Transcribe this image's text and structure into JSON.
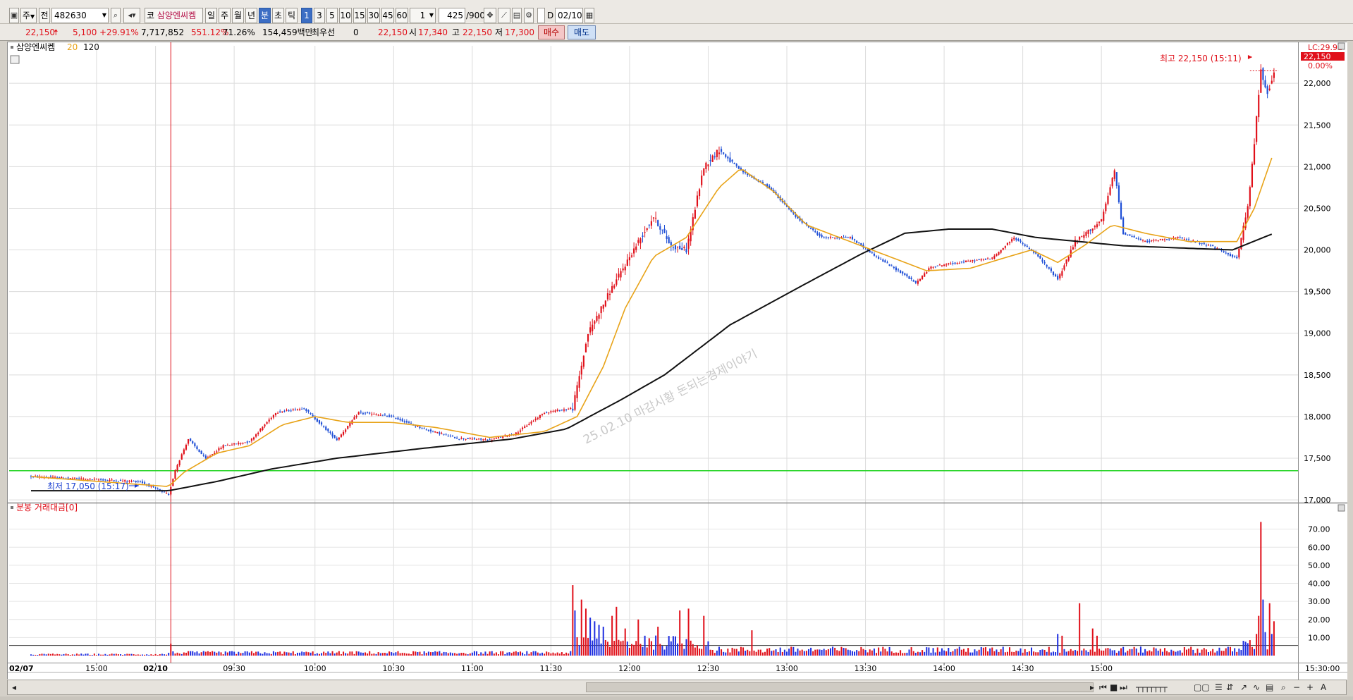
{
  "toolbar": {
    "market_toggle": "주",
    "scope_label": "전",
    "code": "482630",
    "market_prefix": "코",
    "stock_name": "삼양엔씨켐",
    "periods": [
      "일",
      "주",
      "월",
      "년",
      "분",
      "초",
      "틱"
    ],
    "active_period": "분",
    "intervals": [
      "1",
      "3",
      "5",
      "10",
      "15",
      "30",
      "45",
      "60"
    ],
    "active_interval": "1",
    "multiplier": "1",
    "count": "425",
    "count_total": "/900",
    "date_check_label": "D",
    "date": "02/10"
  },
  "quote": {
    "price": "22,150",
    "change": "5,100",
    "change_pct": "+29.91%",
    "volume": "7,717,852",
    "volume_ratio": "551.12%",
    "turnover": "71.26%",
    "amount": "154,459백만",
    "best_priority_label": "최우선",
    "best_priority_value": "0",
    "best_price": "22,150",
    "open_label": "시",
    "open": "17,340",
    "high_label": "고",
    "high": "22,150",
    "low_label": "저",
    "low": "17,300",
    "buy_label": "매수",
    "sell_label": "매도"
  },
  "chart_data": [
    {
      "type": "candlestick",
      "title": "삼양엔씨켐",
      "ma_legend": [
        {
          "name": "20",
          "color": "#e8a318"
        },
        {
          "name": "120",
          "color": "#111111"
        }
      ],
      "x_ticks": [
        "02/07",
        "15:00",
        "02/10",
        "09:30",
        "10:00",
        "10:30",
        "11:00",
        "11:30",
        "12:00",
        "12:30",
        "13:00",
        "13:30",
        "14:00",
        "14:30",
        "15:00",
        "15:30:00"
      ],
      "y_ticks": [
        17000,
        17500,
        18000,
        18500,
        19000,
        19500,
        20000,
        20500,
        21000,
        21500,
        22000
      ],
      "ylim": [
        16950,
        22450
      ],
      "ref_line": {
        "value": 17350,
        "color": "#21d321"
      },
      "lc_label": "LC:29.91",
      "price_tag": "22,150",
      "pct_tag": "0.00%",
      "high_annotation": "최고 22,150 (15:11)",
      "low_annotation": "최저 17,050 (15:17)",
      "watermark": "25.02.10 마감시황 돈되는경제이야기",
      "price_keyframes": [
        {
          "t": 0,
          "v": 17280
        },
        {
          "t": 50,
          "v": 17220
        },
        {
          "t": 63,
          "v": 17060
        },
        {
          "t": 66,
          "v": 17360
        },
        {
          "t": 72,
          "v": 17730
        },
        {
          "t": 80,
          "v": 17490
        },
        {
          "t": 88,
          "v": 17650
        },
        {
          "t": 100,
          "v": 17700
        },
        {
          "t": 112,
          "v": 18050
        },
        {
          "t": 125,
          "v": 18100
        },
        {
          "t": 140,
          "v": 17720
        },
        {
          "t": 150,
          "v": 18050
        },
        {
          "t": 165,
          "v": 18000
        },
        {
          "t": 180,
          "v": 17850
        },
        {
          "t": 195,
          "v": 17740
        },
        {
          "t": 210,
          "v": 17720
        },
        {
          "t": 222,
          "v": 17800
        },
        {
          "t": 235,
          "v": 18050
        },
        {
          "t": 248,
          "v": 18100
        },
        {
          "t": 255,
          "v": 19000
        },
        {
          "t": 265,
          "v": 19500
        },
        {
          "t": 278,
          "v": 20100
        },
        {
          "t": 285,
          "v": 20400
        },
        {
          "t": 293,
          "v": 20050
        },
        {
          "t": 300,
          "v": 20000
        },
        {
          "t": 308,
          "v": 21000
        },
        {
          "t": 315,
          "v": 21200
        },
        {
          "t": 325,
          "v": 20950
        },
        {
          "t": 338,
          "v": 20750
        },
        {
          "t": 350,
          "v": 20400
        },
        {
          "t": 362,
          "v": 20150
        },
        {
          "t": 375,
          "v": 20150
        },
        {
          "t": 388,
          "v": 19900
        },
        {
          "t": 400,
          "v": 19700
        },
        {
          "t": 405,
          "v": 19600
        },
        {
          "t": 412,
          "v": 19800
        },
        {
          "t": 425,
          "v": 19850
        },
        {
          "t": 440,
          "v": 19900
        },
        {
          "t": 450,
          "v": 20150
        },
        {
          "t": 460,
          "v": 19950
        },
        {
          "t": 470,
          "v": 19650
        },
        {
          "t": 478,
          "v": 20100
        },
        {
          "t": 490,
          "v": 20350
        },
        {
          "t": 496,
          "v": 20950
        },
        {
          "t": 500,
          "v": 20200
        },
        {
          "t": 510,
          "v": 20100
        },
        {
          "t": 525,
          "v": 20150
        },
        {
          "t": 540,
          "v": 20050
        },
        {
          "t": 552,
          "v": 19900
        },
        {
          "t": 557,
          "v": 20500
        },
        {
          "t": 560,
          "v": 21300
        },
        {
          "t": 563,
          "v": 22150
        },
        {
          "t": 566,
          "v": 21900
        },
        {
          "t": 569,
          "v": 22100
        }
      ],
      "ma20_keyframes": [
        {
          "t": 0,
          "v": 17280
        },
        {
          "t": 63,
          "v": 17160
        },
        {
          "t": 70,
          "v": 17330
        },
        {
          "t": 85,
          "v": 17560
        },
        {
          "t": 100,
          "v": 17650
        },
        {
          "t": 115,
          "v": 17900
        },
        {
          "t": 130,
          "v": 18000
        },
        {
          "t": 145,
          "v": 17930
        },
        {
          "t": 165,
          "v": 17930
        },
        {
          "t": 185,
          "v": 17870
        },
        {
          "t": 210,
          "v": 17750
        },
        {
          "t": 235,
          "v": 17820
        },
        {
          "t": 250,
          "v": 18000
        },
        {
          "t": 262,
          "v": 18600
        },
        {
          "t": 272,
          "v": 19300
        },
        {
          "t": 285,
          "v": 19920
        },
        {
          "t": 300,
          "v": 20150
        },
        {
          "t": 315,
          "v": 20750
        },
        {
          "t": 325,
          "v": 20980
        },
        {
          "t": 340,
          "v": 20700
        },
        {
          "t": 355,
          "v": 20300
        },
        {
          "t": 375,
          "v": 20100
        },
        {
          "t": 395,
          "v": 19900
        },
        {
          "t": 410,
          "v": 19750
        },
        {
          "t": 430,
          "v": 19780
        },
        {
          "t": 445,
          "v": 19900
        },
        {
          "t": 458,
          "v": 20000
        },
        {
          "t": 470,
          "v": 19850
        },
        {
          "t": 482,
          "v": 20050
        },
        {
          "t": 495,
          "v": 20300
        },
        {
          "t": 510,
          "v": 20200
        },
        {
          "t": 530,
          "v": 20100
        },
        {
          "t": 552,
          "v": 20100
        },
        {
          "t": 560,
          "v": 20500
        },
        {
          "t": 569,
          "v": 21180
        }
      ],
      "ma120_keyframes": [
        {
          "t": 0,
          "v": 17110
        },
        {
          "t": 63,
          "v": 17110
        },
        {
          "t": 85,
          "v": 17220
        },
        {
          "t": 110,
          "v": 17370
        },
        {
          "t": 140,
          "v": 17500
        },
        {
          "t": 180,
          "v": 17620
        },
        {
          "t": 220,
          "v": 17730
        },
        {
          "t": 245,
          "v": 17850
        },
        {
          "t": 270,
          "v": 18200
        },
        {
          "t": 290,
          "v": 18500
        },
        {
          "t": 320,
          "v": 19100
        },
        {
          "t": 355,
          "v": 19600
        },
        {
          "t": 380,
          "v": 19950
        },
        {
          "t": 400,
          "v": 20200
        },
        {
          "t": 420,
          "v": 20250
        },
        {
          "t": 440,
          "v": 20250
        },
        {
          "t": 460,
          "v": 20150
        },
        {
          "t": 480,
          "v": 20100
        },
        {
          "t": 500,
          "v": 20050
        },
        {
          "t": 550,
          "v": 20000
        },
        {
          "t": 569,
          "v": 20200
        }
      ]
    },
    {
      "type": "bar",
      "title": "분봉 거래대금[0]",
      "y_ticks": [
        10,
        20,
        30,
        40,
        50,
        60,
        70
      ],
      "ylim": [
        0,
        80
      ],
      "spikes": [
        {
          "t": 248,
          "v": 39,
          "color": "red"
        },
        {
          "t": 249,
          "v": 25,
          "color": "blue"
        },
        {
          "t": 252,
          "v": 31,
          "color": "red"
        },
        {
          "t": 254,
          "v": 26,
          "color": "red"
        },
        {
          "t": 256,
          "v": 21,
          "color": "blue"
        },
        {
          "t": 258,
          "v": 19,
          "color": "blue"
        },
        {
          "t": 260,
          "v": 17,
          "color": "blue"
        },
        {
          "t": 262,
          "v": 16,
          "color": "blue"
        },
        {
          "t": 266,
          "v": 22,
          "color": "red"
        },
        {
          "t": 268,
          "v": 27,
          "color": "red"
        },
        {
          "t": 272,
          "v": 15,
          "color": "red"
        },
        {
          "t": 278,
          "v": 20,
          "color": "red"
        },
        {
          "t": 281,
          "v": 11,
          "color": "blue"
        },
        {
          "t": 287,
          "v": 16,
          "color": "red"
        },
        {
          "t": 297,
          "v": 25,
          "color": "red"
        },
        {
          "t": 301,
          "v": 26,
          "color": "red"
        },
        {
          "t": 308,
          "v": 22,
          "color": "red"
        },
        {
          "t": 330,
          "v": 14,
          "color": "red"
        },
        {
          "t": 470,
          "v": 12,
          "color": "blue"
        },
        {
          "t": 472,
          "v": 11,
          "color": "red"
        },
        {
          "t": 480,
          "v": 29,
          "color": "red"
        },
        {
          "t": 486,
          "v": 15,
          "color": "red"
        },
        {
          "t": 488,
          "v": 11,
          "color": "red"
        },
        {
          "t": 561,
          "v": 12,
          "color": "red"
        },
        {
          "t": 562,
          "v": 22,
          "color": "red"
        },
        {
          "t": 563,
          "v": 74,
          "color": "red"
        },
        {
          "t": 564,
          "v": 31,
          "color": "blue"
        },
        {
          "t": 565,
          "v": 13,
          "color": "blue"
        },
        {
          "t": 567,
          "v": 29,
          "color": "red"
        },
        {
          "t": 568,
          "v": 12,
          "color": "blue"
        },
        {
          "t": 569,
          "v": 19,
          "color": "red"
        }
      ]
    }
  ]
}
